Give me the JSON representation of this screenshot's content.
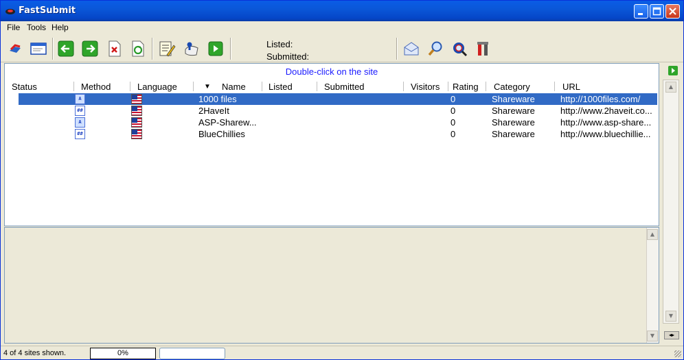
{
  "window": {
    "title": "FastSubmit"
  },
  "menu": [
    "File",
    "Tools",
    "Help"
  ],
  "toolbar": {
    "listed_label": "Listed:",
    "submitted_label": "Submitted:"
  },
  "list": {
    "hint": "Double-click on the site",
    "columns": {
      "status": "Status",
      "method": "Method",
      "language": "Language",
      "sort_arrow": "▼",
      "name": "Name",
      "listed": "Listed",
      "submitted": "Submitted",
      "visitors": "Visitors",
      "rating": "Rating",
      "category": "Category",
      "url": "URL"
    },
    "rows": [
      {
        "name": "1000 files",
        "rating": "0",
        "category": "Shareware",
        "url": "http://1000files.com/",
        "method_icon": "A"
      },
      {
        "name": "2HaveIt",
        "rating": "0",
        "category": "Shareware",
        "url": "http://www.2haveit.co...",
        "method_icon": "##"
      },
      {
        "name": "ASP-Sharew...",
        "rating": "0",
        "category": "Shareware",
        "url": "http://www.asp-share...",
        "method_icon": "A"
      },
      {
        "name": "BlueChillies",
        "rating": "0",
        "category": "Shareware",
        "url": "http://www.bluechillie...",
        "method_icon": "##"
      }
    ]
  },
  "status": {
    "sites_shown": "4 of 4 sites shown.",
    "progress": "0%"
  },
  "icons": [
    "app-logo-icon",
    "open-site-icon",
    "edit-form-icon",
    "back-icon",
    "forward-icon",
    "delete-icon",
    "refresh-icon",
    "notepad-icon",
    "submit-icon",
    "play-icon",
    "email-icon",
    "search-icon",
    "find-icon",
    "tools-icon"
  ]
}
